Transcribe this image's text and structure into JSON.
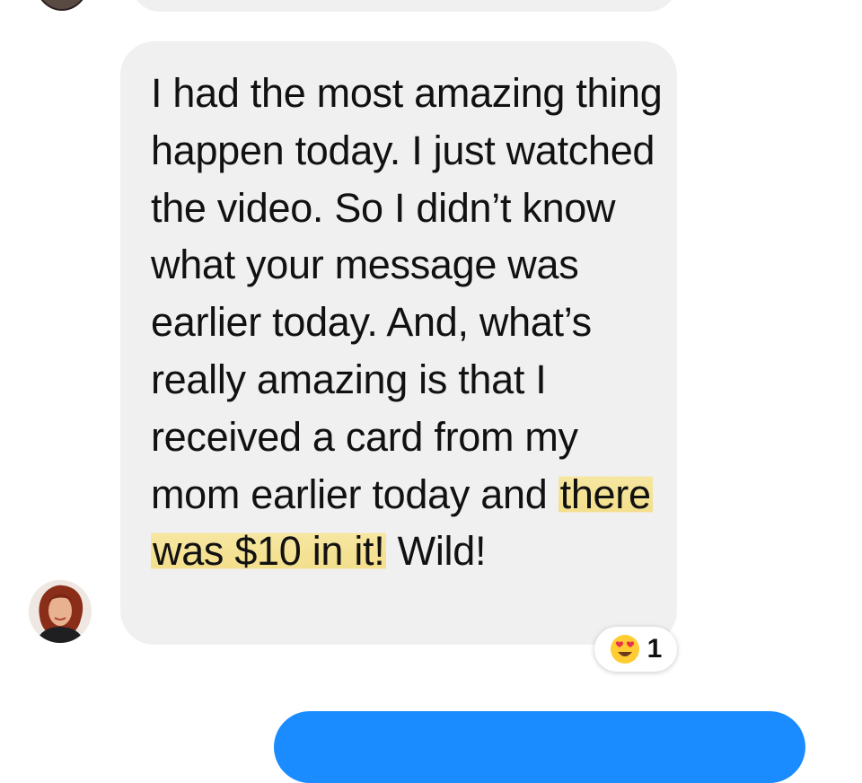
{
  "previous_message": {
    "text": ""
  },
  "message": {
    "text_before": "I had the most amazing thing happen today. I just watched the video. So I didn’t know what your message was earlier today. And, what’s really amazing is that I received a card from my mom earlier today and",
    "highlighted": "there was $10 in it!",
    "text_after": "Wild!"
  },
  "sender": {
    "avatar_icon": "avatar-photo"
  },
  "reaction": {
    "emoji_icon": "heart-eyes-emoji-icon",
    "count": "1"
  },
  "sent_message": {
    "text": ""
  },
  "colors": {
    "received_bubble": "#f0f0f0",
    "sent_bubble": "#1a8cff",
    "highlight": "#f3df8c",
    "text": "#111111"
  }
}
